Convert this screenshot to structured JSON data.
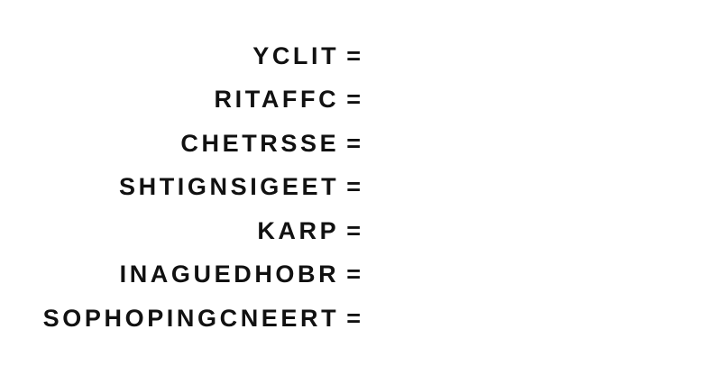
{
  "puzzle": {
    "equals_symbol": "=",
    "words": [
      "YCLIT",
      "RITAFFC",
      "CHETRSSE",
      "SHTIGNSIGEET",
      "KARP",
      "INAGUEDHOBR",
      "SOPHOPINGCNEERT"
    ]
  }
}
